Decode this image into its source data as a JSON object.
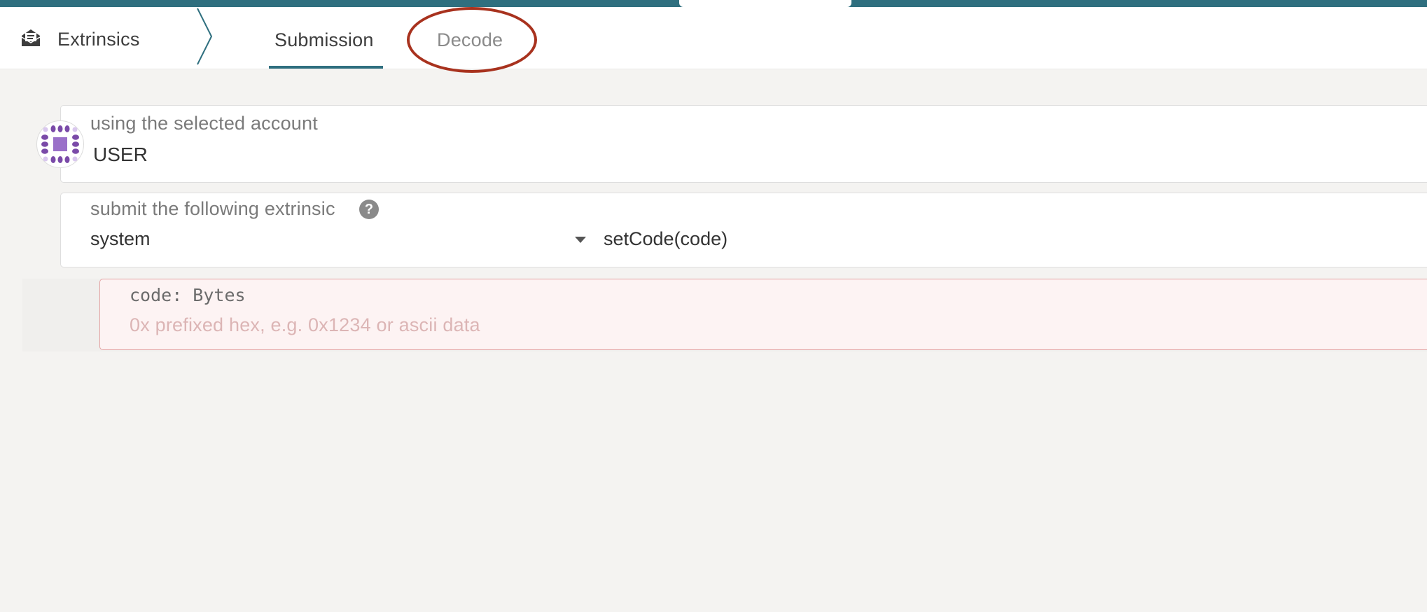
{
  "header": {
    "app_title": "Extrinsics",
    "app_icon": "envelope-open-icon",
    "tabs": [
      {
        "label": "Submission",
        "active": true
      },
      {
        "label": "Decode",
        "active": false,
        "highlighted": true
      }
    ]
  },
  "account": {
    "label": "using the selected account",
    "value": "USER",
    "avatar_icon": "identicon-avatar"
  },
  "extrinsic": {
    "label": "submit the following extrinsic",
    "help_glyph": "?",
    "section": "system",
    "method": "setCode(code)"
  },
  "param": {
    "label": "code: Bytes",
    "placeholder": "0x prefixed hex, e.g. 0x1234 or ascii data"
  },
  "colors": {
    "accent": "#2f6f7f",
    "highlight_circle": "#a8321e",
    "error_background": "#fdf3f3",
    "error_border": "#e3a3a3"
  }
}
